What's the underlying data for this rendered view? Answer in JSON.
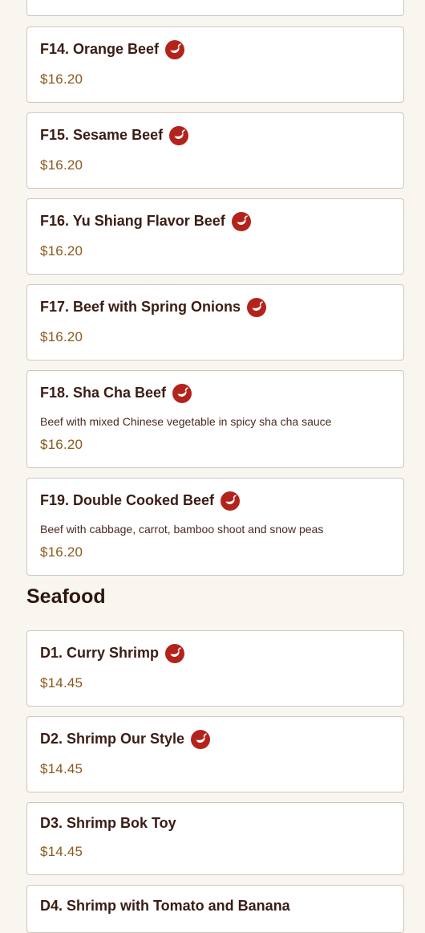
{
  "colors": {
    "background": "#f9f6f0",
    "title": "#3a1d14",
    "price": "#8a5a1c",
    "spicy_icon": "#b3231c"
  },
  "beef_items": [
    {
      "name": "F14. Orange Beef",
      "price": "$16.20",
      "spicy": true
    },
    {
      "name": "F15. Sesame Beef",
      "price": "$16.20",
      "spicy": true
    },
    {
      "name": "F16. Yu Shiang Flavor Beef",
      "price": "$16.20",
      "spicy": true
    },
    {
      "name": "F17. Beef with Spring Onions",
      "price": "$16.20",
      "spicy": true
    },
    {
      "name": "F18. Sha Cha Beef",
      "price": "$16.20",
      "spicy": true,
      "description": "Beef with mixed Chinese vegetable in spicy sha cha sauce"
    },
    {
      "name": "F19. Double Cooked Beef",
      "price": "$16.20",
      "spicy": true,
      "description": "Beef with cabbage, carrot, bamboo shoot and snow peas"
    }
  ],
  "seafood_section": {
    "title": "Seafood",
    "items": [
      {
        "name": "D1. Curry Shrimp",
        "price": "$14.45",
        "spicy": true
      },
      {
        "name": "D2. Shrimp Our Style",
        "price": "$14.45",
        "spicy": true
      },
      {
        "name": "D3. Shrimp Bok Toy",
        "price": "$14.45",
        "spicy": false
      },
      {
        "name": "D4. Shrimp with Tomato and Banana",
        "spicy": false
      }
    ]
  }
}
